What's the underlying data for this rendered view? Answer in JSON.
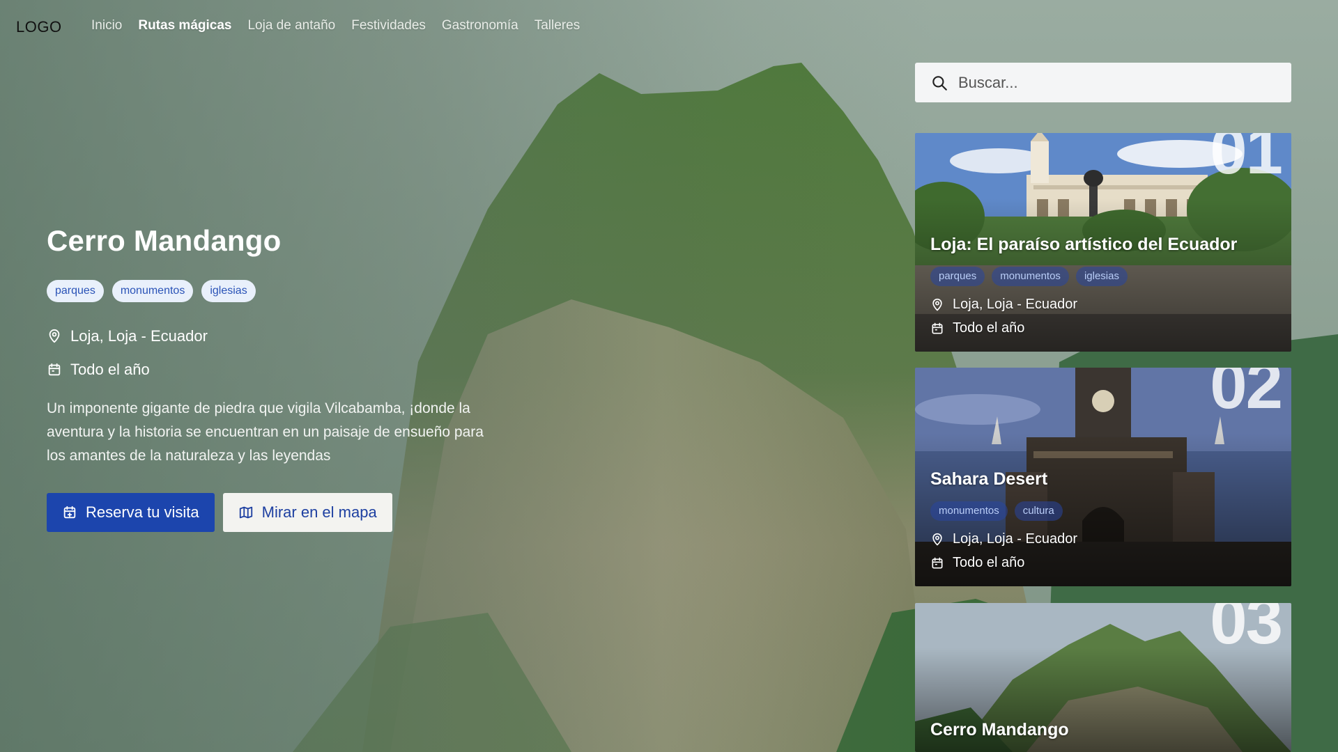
{
  "nav": {
    "logo": "LOGO",
    "links": [
      {
        "label": "Inicio",
        "active": false
      },
      {
        "label": "Rutas mágicas",
        "active": true
      },
      {
        "label": "Loja de antaño",
        "active": false
      },
      {
        "label": "Festividades",
        "active": false
      },
      {
        "label": "Gastronomía",
        "active": false
      },
      {
        "label": "Talleres",
        "active": false
      }
    ]
  },
  "hero": {
    "title": "Cerro Mandango",
    "tags": [
      "parques",
      "monumentos",
      "iglesias"
    ],
    "location": "Loja, Loja - Ecuador",
    "season": "Todo el año",
    "description": "Un imponente gigante de piedra que vigila Vilcabamba, ¡donde la aventura y la historia se encuentran en un paisaje de ensueño para los amantes de la naturaleza y las leyendas",
    "primary_button": "Reserva tu visita",
    "secondary_button": "Mirar en el mapa"
  },
  "search": {
    "placeholder": "Buscar..."
  },
  "cards": [
    {
      "number": "01",
      "title": "Loja: El paraíso artístico del Ecuador",
      "tags": [
        "parques",
        "monumentos",
        "iglesias"
      ],
      "location": "Loja, Loja - Ecuador",
      "season": "Todo el año"
    },
    {
      "number": "02",
      "title": "Sahara Desert",
      "tags": [
        "monumentos",
        "cultura"
      ],
      "location": "Loja, Loja - Ecuador",
      "season": "Todo el año"
    },
    {
      "number": "03",
      "title": "Cerro Mandango"
    }
  ],
  "colors": {
    "primary": "#1c45ad",
    "tag_bg": "#e9f0fb",
    "tag_text": "#2a53b7"
  }
}
